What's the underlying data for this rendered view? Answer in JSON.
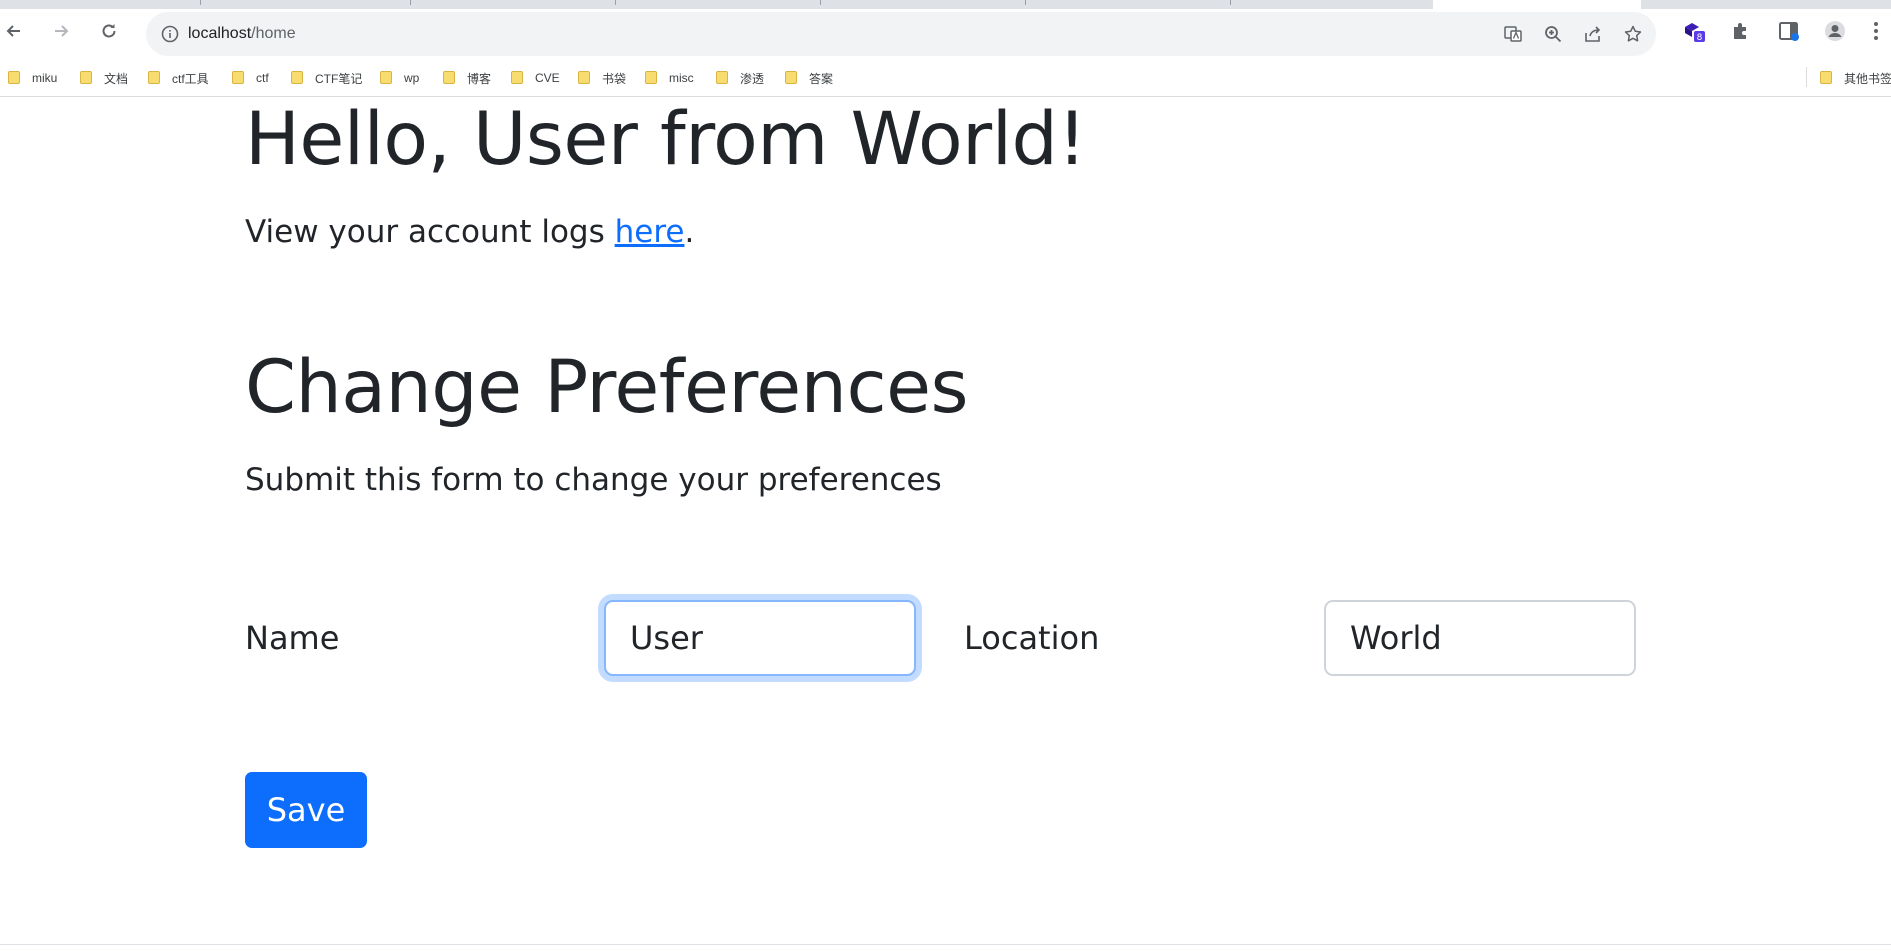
{
  "browser": {
    "url_host": "localhost",
    "url_path": "/home"
  },
  "bookmarks": [
    {
      "label": "miku"
    },
    {
      "label": "文档"
    },
    {
      "label": "ctf工具"
    },
    {
      "label": "ctf"
    },
    {
      "label": "CTF笔记"
    },
    {
      "label": "wp"
    },
    {
      "label": "博客"
    },
    {
      "label": "CVE"
    },
    {
      "label": "书袋"
    },
    {
      "label": "misc"
    },
    {
      "label": "渗透"
    },
    {
      "label": "答案"
    }
  ],
  "other_bookmarks": "其他书签",
  "extension_badge": "8",
  "page": {
    "greeting": "Hello, User from World!",
    "logs_prefix": "View your account logs ",
    "logs_link": "here",
    "logs_suffix": ".",
    "pref_title": "Change Preferences",
    "pref_subtitle": "Submit this form to change your preferences"
  },
  "form": {
    "name_label": "Name",
    "name_value": "User",
    "location_label": "Location",
    "location_value": "World",
    "save_label": "Save"
  },
  "colors": {
    "primary": "#0d6efd",
    "text": "#212529",
    "focus_ring": "#86b7fe",
    "folder": "#f9dc70"
  }
}
